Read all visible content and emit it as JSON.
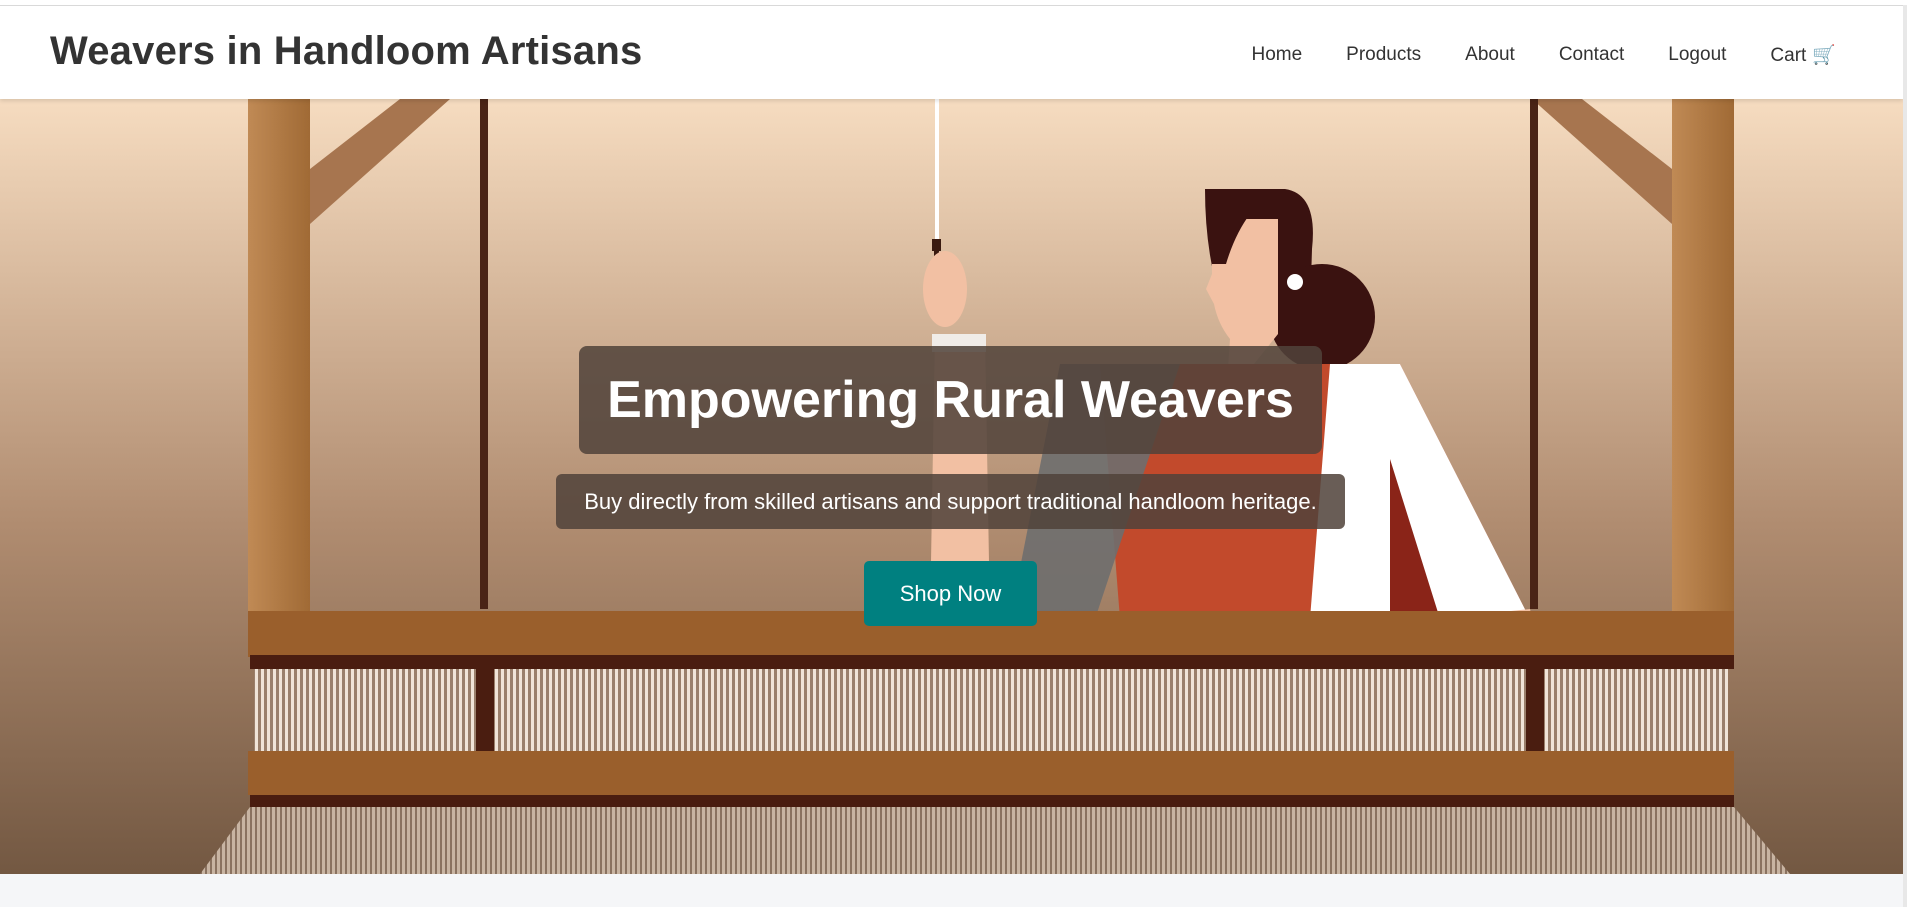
{
  "header": {
    "brand": "Weavers in Handloom Artisans",
    "nav": [
      {
        "label": "Home"
      },
      {
        "label": "Products"
      },
      {
        "label": "About"
      },
      {
        "label": "Contact"
      },
      {
        "label": "Logout"
      },
      {
        "label": "Cart"
      }
    ],
    "cart_icon": "shopping-cart-icon"
  },
  "hero": {
    "title": "Empowering Rural Weavers",
    "subtitle": "Buy directly from skilled artisans and support traditional handloom heritage.",
    "cta_label": "Shop Now",
    "image": "woman-weaving-on-handloom-illustration"
  },
  "colors": {
    "accent": "#008080",
    "brand_text": "#333333",
    "overlay": "#50423a",
    "loom_wood": "#9a5f2c",
    "saree": "#c24a2c"
  }
}
